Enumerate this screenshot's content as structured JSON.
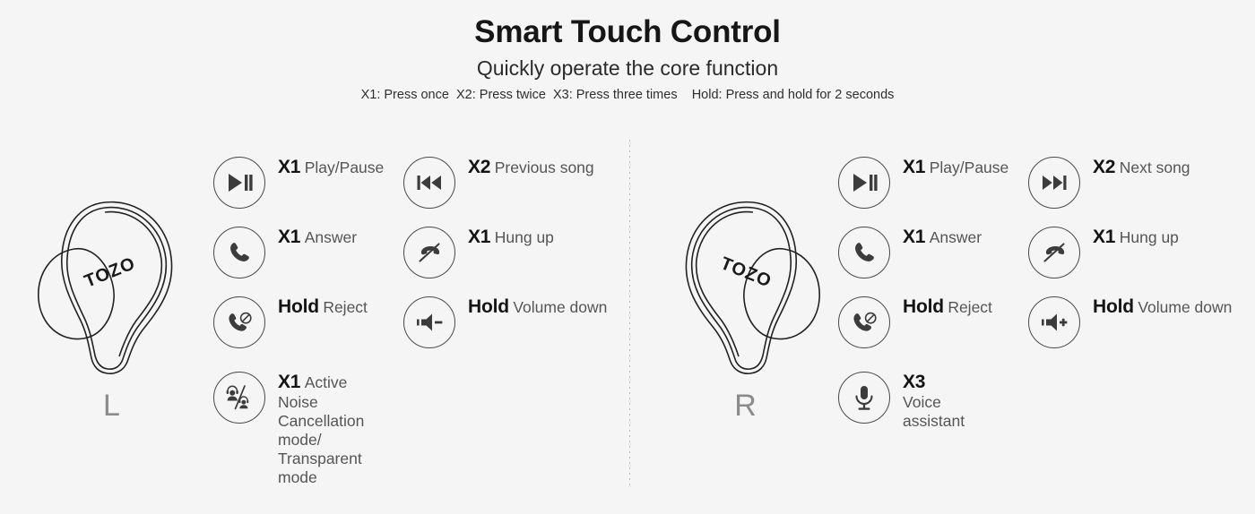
{
  "header": {
    "title": "Smart Touch Control",
    "subtitle": "Quickly operate the core function",
    "legend_1": "X1: Press once",
    "legend_2": "X2: Press twice",
    "legend_3": "X3: Press three times",
    "legend_4": "Hold: Press and hold for 2 seconds"
  },
  "colors": {
    "background": "#f5f5f5",
    "title": "#161616",
    "count": "#141414",
    "label": "#555555",
    "icon_stroke": "#4a4a4a",
    "earbud_line": "#222222",
    "letter": "#8b8b8b",
    "divider": "#b9b9b9"
  },
  "left": {
    "bud_brand": "TOZO",
    "letter": "L",
    "column_a": [
      {
        "icon": "play-pause-icon",
        "count": "X1",
        "label": "Play/Pause"
      },
      {
        "icon": "phone-answer-icon",
        "count": "X1",
        "label": "Answer"
      },
      {
        "icon": "phone-reject-icon",
        "count": "Hold",
        "label": "Reject"
      }
    ],
    "column_b": [
      {
        "icon": "previous-song-icon",
        "count": "X2",
        "label": "Previous song"
      },
      {
        "icon": "phone-hangup-icon",
        "count": "X1",
        "label": "Hung up"
      },
      {
        "icon": "volume-down-icon",
        "count": "Hold",
        "label": "Volume down"
      }
    ],
    "wide_row": {
      "icon": "noise-cancellation-icon",
      "count": "X1",
      "label": "Active Noise Cancellation mode/\nTransparent mode"
    }
  },
  "right": {
    "bud_brand": "TOZO",
    "letter": "R",
    "column_a": [
      {
        "icon": "play-pause-icon",
        "count": "X1",
        "label": "Play/Pause"
      },
      {
        "icon": "phone-answer-icon",
        "count": "X1",
        "label": "Answer"
      },
      {
        "icon": "phone-reject-icon",
        "count": "Hold",
        "label": "Reject"
      }
    ],
    "column_b": [
      {
        "icon": "next-song-icon",
        "count": "X2",
        "label": "Next song"
      },
      {
        "icon": "phone-hangup-icon",
        "count": "X1",
        "label": "Hung up"
      },
      {
        "icon": "volume-up-icon",
        "count": "Hold",
        "label": "Volume down"
      }
    ],
    "wide_row": {
      "icon": "microphone-icon",
      "count": "X3",
      "label": "Voice  assistant"
    }
  }
}
